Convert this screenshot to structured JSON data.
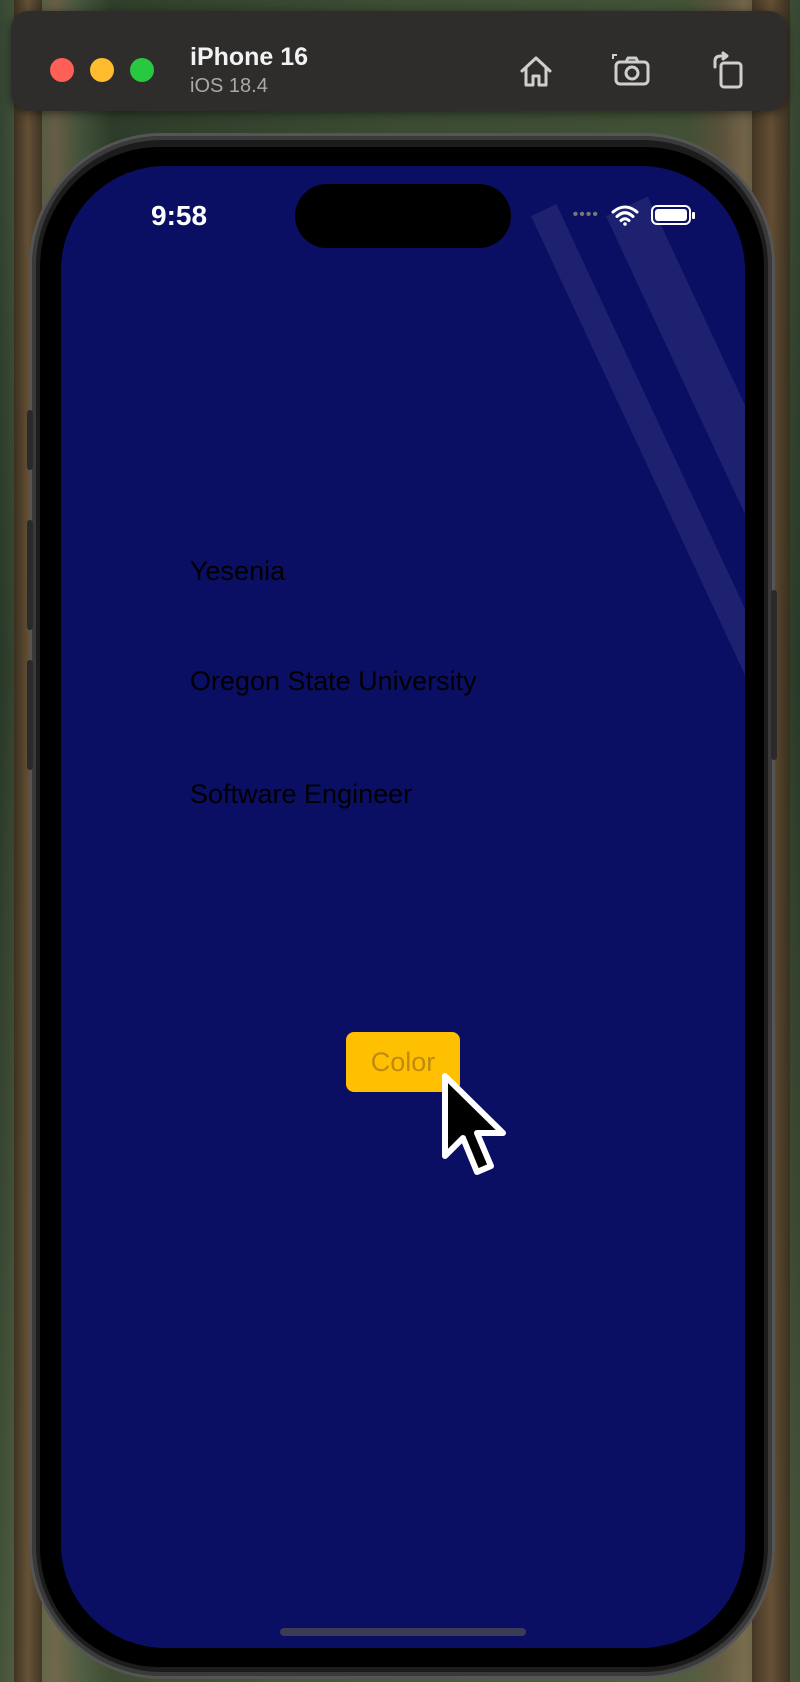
{
  "window": {
    "device_name": "iPhone 16",
    "os_version": "iOS 18.4",
    "toolbar_icons": [
      "home-icon",
      "screenshot-icon",
      "rotate-icon"
    ]
  },
  "status_bar": {
    "time": "9:58",
    "icons": [
      "signal-icon",
      "wifi-icon",
      "battery-icon"
    ]
  },
  "app": {
    "background_color": "#0a0f63",
    "name": "Yesenia",
    "school": "Oregon State University",
    "job": "Software Engineer",
    "button_label": "Color",
    "button_color": "#fec000"
  },
  "cursor": "pointer-cursor"
}
